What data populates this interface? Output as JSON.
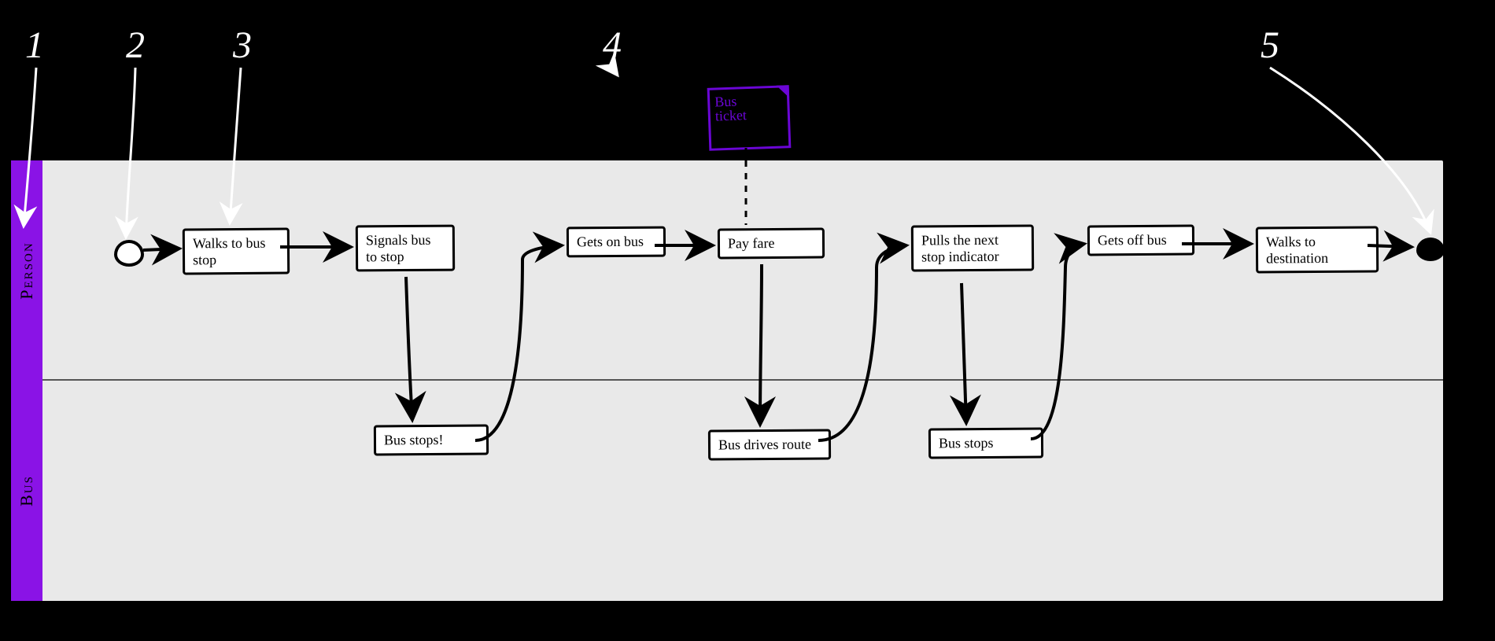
{
  "labels": {
    "n1": "1",
    "n2": "2",
    "n3": "3",
    "n4": "4",
    "n5": "5"
  },
  "lanes": {
    "person": "Person",
    "bus": "Bus"
  },
  "ticket": {
    "line1": "Bus",
    "line2": "ticket"
  },
  "boxes": {
    "walk_to_stop": "Walks to bus stop",
    "signal_stop": "Signals bus to stop",
    "bus_stops1": "Bus stops!",
    "gets_on": "Gets on bus",
    "pay_fare": "Pay fare",
    "drives_route": "Bus drives route",
    "pulls_indicator": "Pulls the next stop indicator",
    "bus_stops2": "Bus stops",
    "gets_off": "Gets off bus",
    "walk_dest": "Walks to destination"
  },
  "chart_data": {
    "type": "swimlane-flow",
    "title": "",
    "lanes": [
      "Person",
      "Bus"
    ],
    "annotations": [
      {
        "id": 1,
        "points_to": "lane_header"
      },
      {
        "id": 2,
        "points_to": "start"
      },
      {
        "id": 3,
        "points_to": "Walks to bus stop"
      },
      {
        "id": 4,
        "points_to": "Pay fare"
      },
      {
        "id": 5,
        "points_to": "end"
      }
    ],
    "artifacts": [
      {
        "name": "Bus ticket",
        "attached_to": "Pay fare"
      }
    ],
    "nodes": [
      {
        "id": "start",
        "type": "start",
        "lane": "Person"
      },
      {
        "id": "a1",
        "type": "task",
        "lane": "Person",
        "label": "Walks to bus stop"
      },
      {
        "id": "a2",
        "type": "task",
        "lane": "Person",
        "label": "Signals bus to stop"
      },
      {
        "id": "b1",
        "type": "task",
        "lane": "Bus",
        "label": "Bus stops!"
      },
      {
        "id": "a3",
        "type": "task",
        "lane": "Person",
        "label": "Gets on bus"
      },
      {
        "id": "a4",
        "type": "task",
        "lane": "Person",
        "label": "Pay fare"
      },
      {
        "id": "b2",
        "type": "task",
        "lane": "Bus",
        "label": "Bus drives route"
      },
      {
        "id": "a5",
        "type": "task",
        "lane": "Person",
        "label": "Pulls the next stop indicator"
      },
      {
        "id": "b3",
        "type": "task",
        "lane": "Bus",
        "label": "Bus stops"
      },
      {
        "id": "a6",
        "type": "task",
        "lane": "Person",
        "label": "Gets off bus"
      },
      {
        "id": "a7",
        "type": "task",
        "lane": "Person",
        "label": "Walks to destination"
      },
      {
        "id": "end",
        "type": "end",
        "lane": "Person"
      }
    ],
    "edges": [
      [
        "start",
        "a1"
      ],
      [
        "a1",
        "a2"
      ],
      [
        "a2",
        "b1"
      ],
      [
        "b1",
        "a3"
      ],
      [
        "a3",
        "a4"
      ],
      [
        "a4",
        "b2"
      ],
      [
        "b2",
        "a5"
      ],
      [
        "a5",
        "b3"
      ],
      [
        "b3",
        "a6"
      ],
      [
        "a6",
        "a7"
      ],
      [
        "a7",
        "end"
      ]
    ]
  }
}
